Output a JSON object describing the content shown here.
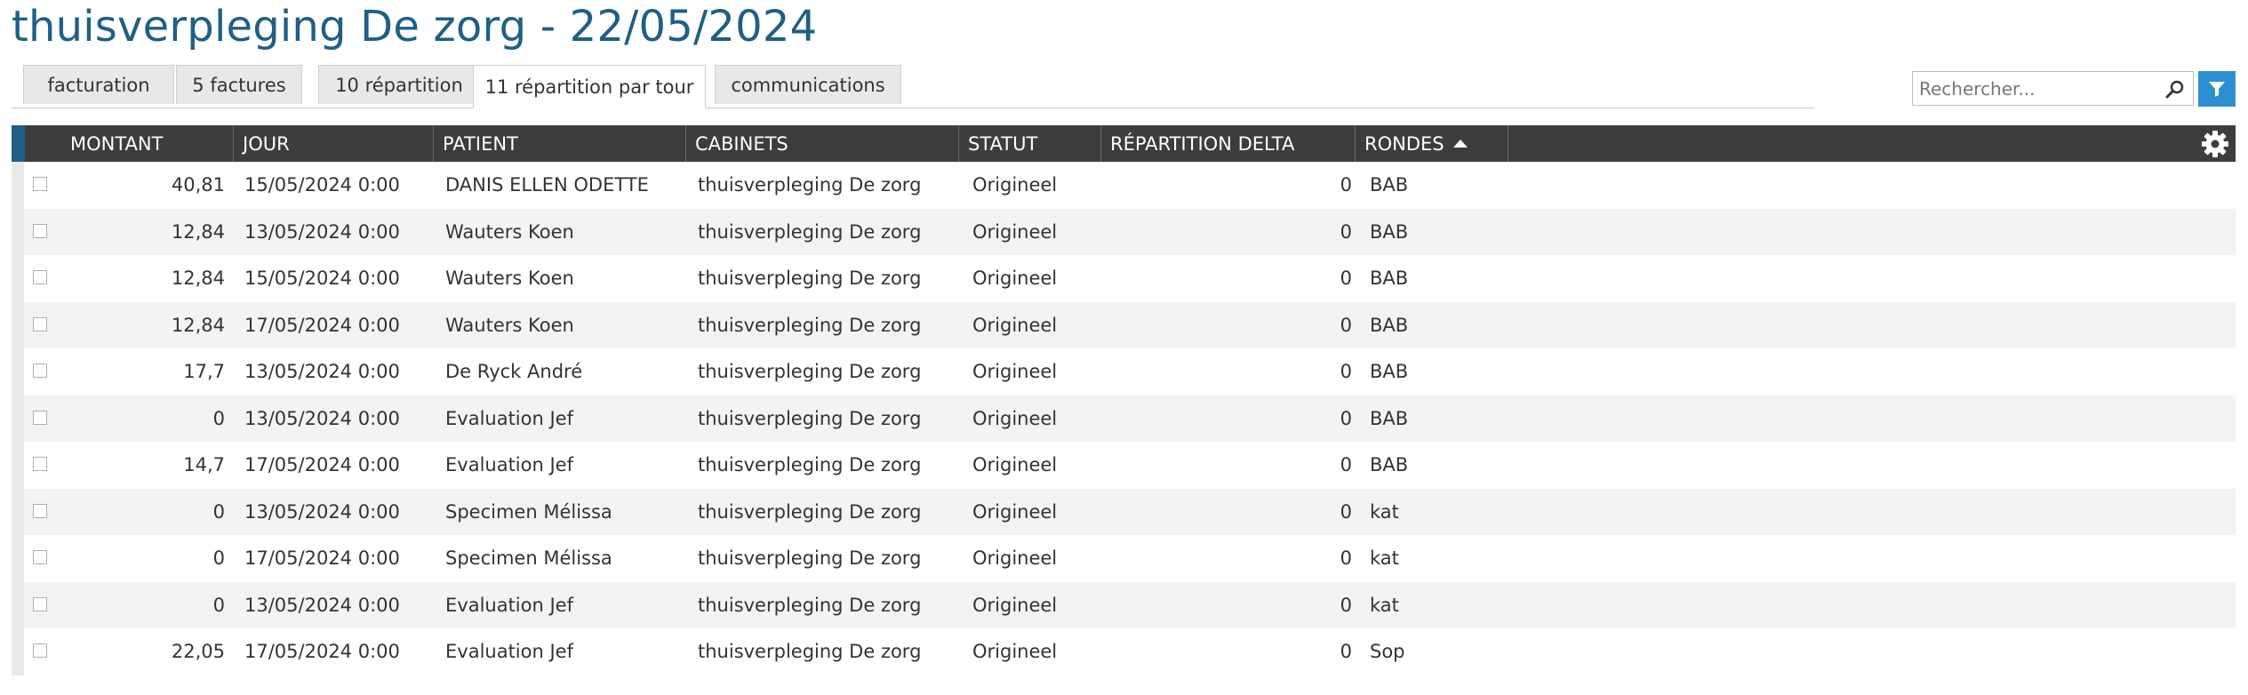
{
  "page_title": "thuisverpleging De zorg - 22/05/2024",
  "tabs": [
    {
      "label": "facturation"
    },
    {
      "label": "5 factures"
    },
    {
      "label": "10 répartition"
    },
    {
      "label": "11 répartition par tour"
    },
    {
      "label": "communications"
    }
  ],
  "active_tab": "11 répartition par tour",
  "search": {
    "placeholder": "Rechercher..."
  },
  "icons": {
    "search": "magnifier-icon",
    "filter": "funnel-icon",
    "settings": "gear-icon",
    "sort": "sort-ascending-icon"
  },
  "colors": {
    "title": "#1f5f86",
    "header_bg": "#3d3d3d",
    "accent": "#2e8fd0"
  },
  "columns": {
    "montant": "MONTANT",
    "jour": "JOUR",
    "patient": "PATIENT",
    "cabinets": "CABINETS",
    "statut": "STATUT",
    "repartition_delta": "RÉPARTITION DELTA",
    "rondes": "RONDES"
  },
  "sorted_column": "RONDES",
  "rows": [
    {
      "montant": "40,81",
      "jour": "15/05/2024 0:00",
      "patient": "DANIS ELLEN ODETTE",
      "cabinets": "thuisverpleging De zorg",
      "statut": "Origineel",
      "delta": "0",
      "rondes": "BAB"
    },
    {
      "montant": "12,84",
      "jour": "13/05/2024 0:00",
      "patient": "Wauters Koen",
      "cabinets": "thuisverpleging De zorg",
      "statut": "Origineel",
      "delta": "0",
      "rondes": "BAB"
    },
    {
      "montant": "12,84",
      "jour": "15/05/2024 0:00",
      "patient": "Wauters Koen",
      "cabinets": "thuisverpleging De zorg",
      "statut": "Origineel",
      "delta": "0",
      "rondes": "BAB"
    },
    {
      "montant": "12,84",
      "jour": "17/05/2024 0:00",
      "patient": "Wauters Koen",
      "cabinets": "thuisverpleging De zorg",
      "statut": "Origineel",
      "delta": "0",
      "rondes": "BAB"
    },
    {
      "montant": "17,7",
      "jour": "13/05/2024 0:00",
      "patient": "De Ryck André",
      "cabinets": "thuisverpleging De zorg",
      "statut": "Origineel",
      "delta": "0",
      "rondes": "BAB"
    },
    {
      "montant": "0",
      "jour": "13/05/2024 0:00",
      "patient": "Evaluation Jef",
      "cabinets": "thuisverpleging De zorg",
      "statut": "Origineel",
      "delta": "0",
      "rondes": "BAB"
    },
    {
      "montant": "14,7",
      "jour": "17/05/2024 0:00",
      "patient": "Evaluation Jef",
      "cabinets": "thuisverpleging De zorg",
      "statut": "Origineel",
      "delta": "0",
      "rondes": "BAB"
    },
    {
      "montant": "0",
      "jour": "13/05/2024 0:00",
      "patient": "Specimen Mélissa",
      "cabinets": "thuisverpleging De zorg",
      "statut": "Origineel",
      "delta": "0",
      "rondes": "kat"
    },
    {
      "montant": "0",
      "jour": "17/05/2024 0:00",
      "patient": "Specimen Mélissa",
      "cabinets": "thuisverpleging De zorg",
      "statut": "Origineel",
      "delta": "0",
      "rondes": "kat"
    },
    {
      "montant": "0",
      "jour": "13/05/2024 0:00",
      "patient": "Evaluation Jef",
      "cabinets": "thuisverpleging De zorg",
      "statut": "Origineel",
      "delta": "0",
      "rondes": "kat"
    },
    {
      "montant": "22,05",
      "jour": "17/05/2024 0:00",
      "patient": "Evaluation Jef",
      "cabinets": "thuisverpleging De zorg",
      "statut": "Origineel",
      "delta": "0",
      "rondes": "Sop"
    }
  ]
}
